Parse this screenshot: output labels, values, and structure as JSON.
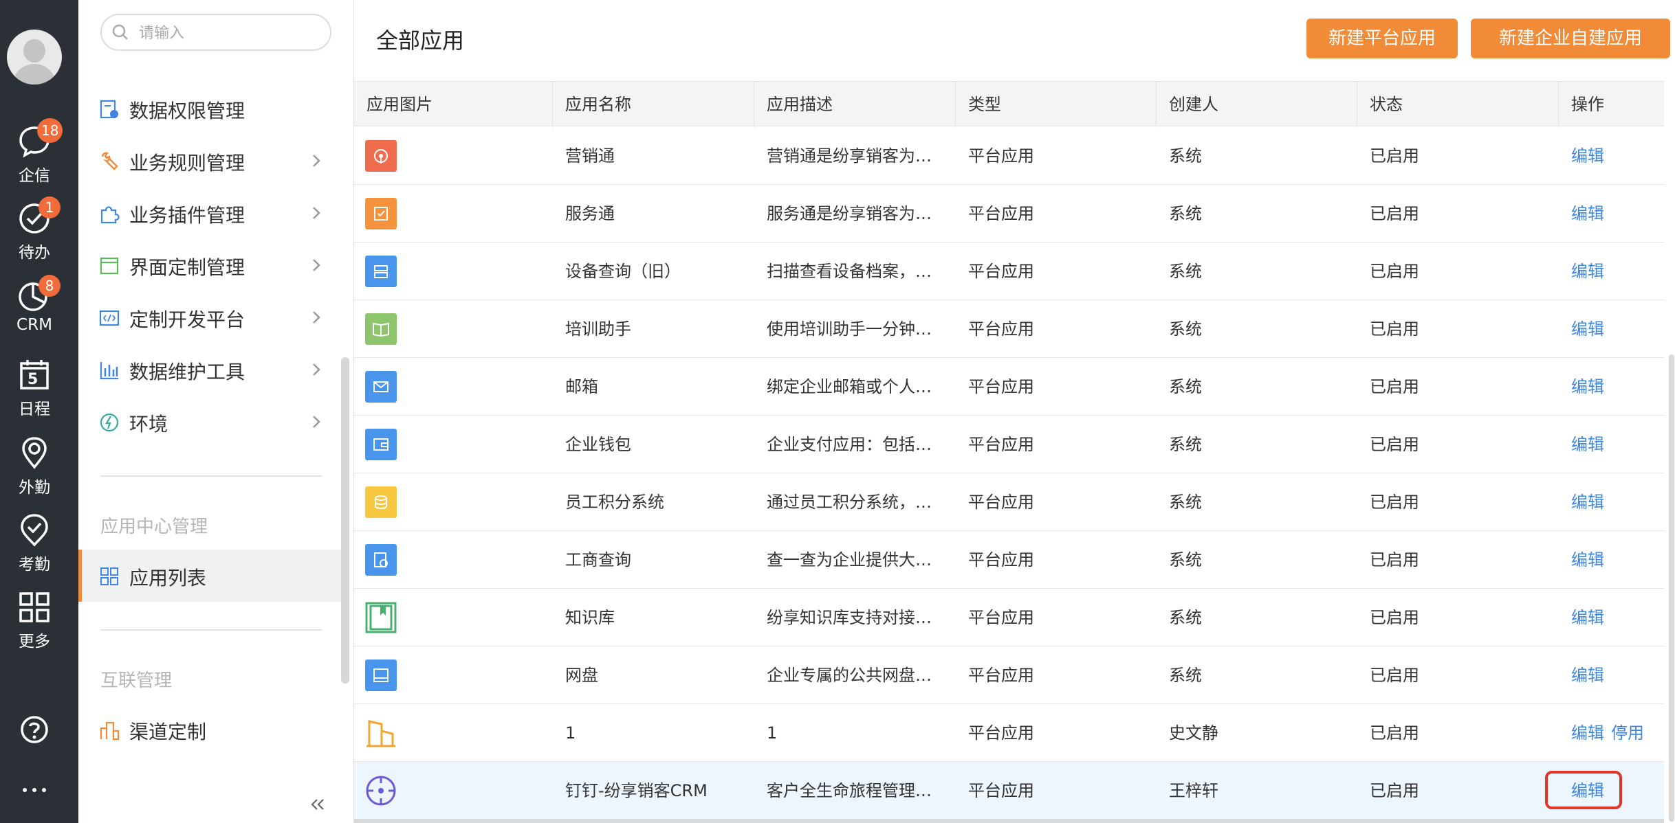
{
  "rail": {
    "items": [
      {
        "label": "企信",
        "icon": "chat-icon",
        "badge": "18"
      },
      {
        "label": "待办",
        "icon": "todo-check-icon",
        "badge": "1"
      },
      {
        "label": "CRM",
        "icon": "pie-chart-icon",
        "badge": "8"
      },
      {
        "label": "日程",
        "icon": "calendar-icon",
        "day": "5"
      },
      {
        "label": "外勤",
        "icon": "location-pin-icon"
      },
      {
        "label": "考勤",
        "icon": "attendance-icon"
      },
      {
        "label": "更多",
        "icon": "grid-more-icon"
      }
    ],
    "help_icon": "help-icon",
    "more_icon": "ellipsis-icon"
  },
  "menu": {
    "search_placeholder": "请输入",
    "items": [
      {
        "label": "数据权限管理",
        "icon": "data-permission-icon"
      },
      {
        "label": "业务规则管理",
        "icon": "wrench-icon"
      },
      {
        "label": "业务插件管理",
        "icon": "puzzle-icon"
      },
      {
        "label": "界面定制管理",
        "icon": "window-icon"
      },
      {
        "label": "定制开发平台",
        "icon": "code-icon"
      },
      {
        "label": "数据维护工具",
        "icon": "bar-chart-icon"
      },
      {
        "label": "环境",
        "icon": "environment-icon"
      }
    ],
    "group_app_center": "应用中心管理",
    "app_list": "应用列表",
    "group_interconnect": "互联管理",
    "channel": "渠道定制"
  },
  "main": {
    "title": "全部应用",
    "btn_platform": "新建平台应用",
    "btn_enterprise": "新建企业自建应用",
    "columns": [
      "应用图片",
      "应用名称",
      "应用描述",
      "类型",
      "创建人",
      "状态",
      "操作"
    ],
    "rows": [
      {
        "name": "营销通",
        "desc": "营销通是纷享销客为…",
        "type": "平台应用",
        "creator": "系统",
        "status": "已启用",
        "edit": "编辑",
        "icon_color": "#f06c4f",
        "icon": "marketing-icon"
      },
      {
        "name": "服务通",
        "desc": "服务通是纷享销客为…",
        "type": "平台应用",
        "creator": "系统",
        "status": "已启用",
        "edit": "编辑",
        "icon_color": "#f5923e",
        "icon": "service-icon"
      },
      {
        "name": "设备查询（旧）",
        "desc": "扫描查看设备档案，…",
        "type": "平台应用",
        "creator": "系统",
        "status": "已启用",
        "edit": "编辑",
        "icon_color": "#4a95ec",
        "icon": "device-icon"
      },
      {
        "name": "培训助手",
        "desc": "使用培训助手一分钟…",
        "type": "平台应用",
        "creator": "系统",
        "status": "已启用",
        "edit": "编辑",
        "icon_color": "#8cc56c",
        "icon": "book-icon"
      },
      {
        "name": "邮箱",
        "desc": "绑定企业邮箱或个人…",
        "type": "平台应用",
        "creator": "系统",
        "status": "已启用",
        "edit": "编辑",
        "icon_color": "#4a95ec",
        "icon": "mail-icon"
      },
      {
        "name": "企业钱包",
        "desc": "企业支付应用：包括…",
        "type": "平台应用",
        "creator": "系统",
        "status": "已启用",
        "edit": "编辑",
        "icon_color": "#4a95ec",
        "icon": "wallet-icon"
      },
      {
        "name": "员工积分系统",
        "desc": "通过员工积分系统，…",
        "type": "平台应用",
        "creator": "系统",
        "status": "已启用",
        "edit": "编辑",
        "icon_color": "#f6c73f",
        "icon": "coins-icon"
      },
      {
        "name": "工商查询",
        "desc": "查一查为企业提供大…",
        "type": "平台应用",
        "creator": "系统",
        "status": "已启用",
        "edit": "编辑",
        "icon_color": "#4a95ec",
        "icon": "business-query-icon"
      },
      {
        "name": "知识库",
        "desc": "纷享知识库支持对接…",
        "type": "平台应用",
        "creator": "系统",
        "status": "已启用",
        "edit": "编辑",
        "icon_color": "#4caf72",
        "icon": "knowledge-icon"
      },
      {
        "name": "网盘",
        "desc": "企业专属的公共网盘…",
        "type": "平台应用",
        "creator": "系统",
        "status": "已启用",
        "edit": "编辑",
        "icon_color": "#4a95ec",
        "icon": "disk-icon"
      },
      {
        "name": "1",
        "desc": "1",
        "type": "平台应用",
        "creator": "史文静",
        "status": "已启用",
        "edit": "编辑",
        "disable": "停用",
        "icon_color": "#f2a531",
        "icon": "building-icon"
      },
      {
        "name": "钉钉-纷享销客CRM",
        "desc": "客户全生命旅程管理…",
        "type": "平台应用",
        "creator": "王梓轩",
        "status": "已启用",
        "edit": "编辑",
        "icon_color": "#6a5ad6",
        "icon": "target-icon"
      }
    ]
  }
}
